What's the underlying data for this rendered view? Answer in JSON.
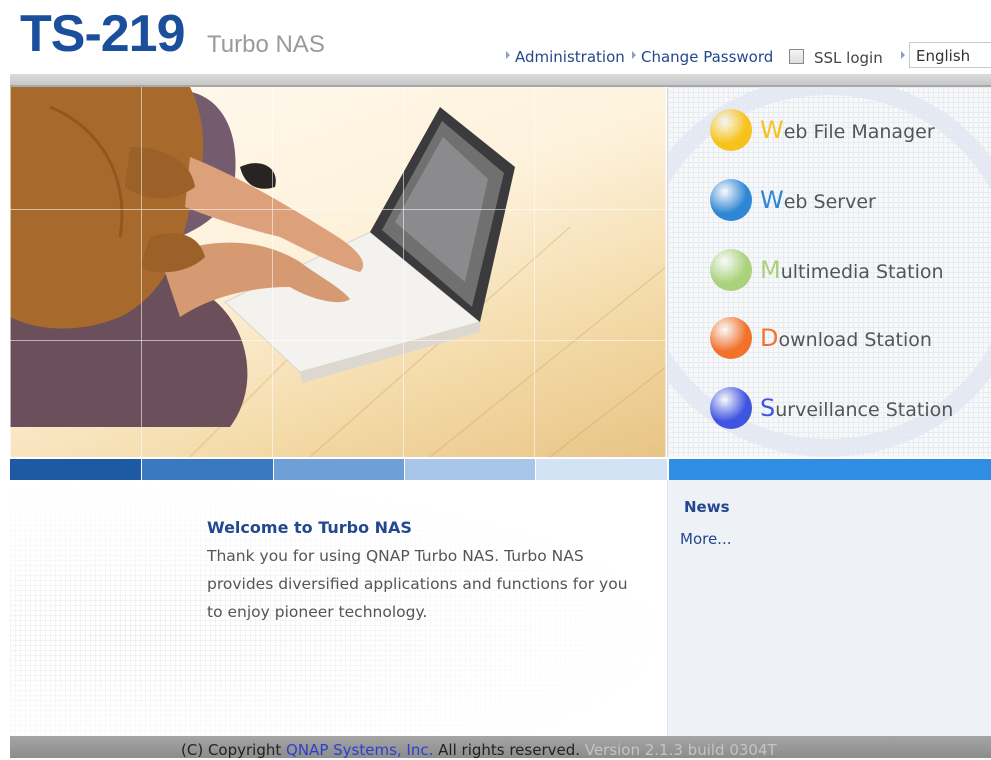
{
  "header": {
    "model": "TS-219",
    "product": "Turbo NAS",
    "links": [
      "Administration",
      "Change Password"
    ],
    "ssl_label": "SSL login",
    "ssl_checked": false,
    "language": "English"
  },
  "menu": [
    {
      "initial": "W",
      "rest": "eb File Manager",
      "color": "#f7c21b",
      "icon": "web-file-manager-icon"
    },
    {
      "initial": "W",
      "rest": "eb Server",
      "color": "#2f86d4",
      "icon": "web-server-icon"
    },
    {
      "initial": "M",
      "rest": "ultimedia Station",
      "color": "#a9d27a",
      "icon": "multimedia-station-icon"
    },
    {
      "initial": "D",
      "rest": "ownload Station",
      "color": "#f2722b",
      "icon": "download-station-icon"
    },
    {
      "initial": "S",
      "rest": "urveillance Station",
      "color": "#3f54e0",
      "icon": "surveillance-station-icon"
    }
  ],
  "stripe_colors": [
    "#1d5aa3",
    "#3a78bf",
    "#6e9fd6",
    "#a7c6ea",
    "#d2e3f6",
    "#2f8de4"
  ],
  "welcome": {
    "title": "Welcome to Turbo NAS",
    "lines": [
      "Thank you for using QNAP Turbo NAS. Turbo NAS",
      "provides diversified applications and functions for you",
      "to enjoy pioneer technology."
    ]
  },
  "news": {
    "title": "News",
    "more": "More..."
  },
  "footer": {
    "copyright": "(C) Copyright",
    "company": "QNAP Systems, Inc.",
    "rights": "All rights reserved.",
    "version": "Version 2.1.3 build 0304T"
  }
}
